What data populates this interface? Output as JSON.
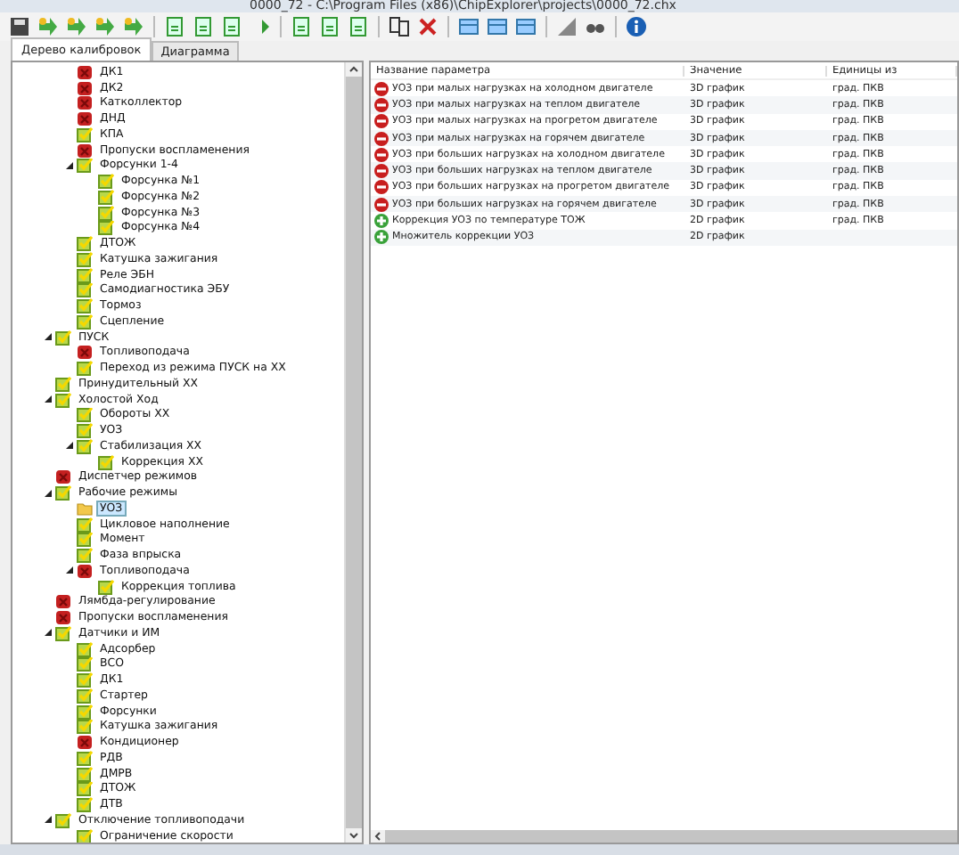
{
  "window": {
    "title": "0000_72 - C:\\Program Files (x86)\\ChipExplorer\\projects\\0000_72.chx"
  },
  "tabs": [
    {
      "label": "Дерево калибровок",
      "selected": true
    },
    {
      "label": "Диаграмма",
      "selected": false
    }
  ],
  "tree": {
    "continued": [
      {
        "label": "ДК1",
        "kind": "error",
        "selected": false
      },
      {
        "label": "ДК2",
        "kind": "error",
        "selected": false
      },
      {
        "label": "Катколлектор",
        "kind": "error",
        "selected": false
      },
      {
        "label": "ДНД",
        "kind": "error",
        "selected": false
      },
      {
        "label": "КПА",
        "kind": "ok",
        "selected": false
      },
      {
        "label": "Пропуски воспламенения",
        "kind": "error",
        "selected": false
      },
      {
        "label": "Форсунки 1-4",
        "kind": "ok",
        "selected": false,
        "expanded": true,
        "children": [
          {
            "label": "Форсунка №1",
            "kind": "ok",
            "selected": false
          },
          {
            "label": "Форсунка №2",
            "kind": "ok",
            "selected": false
          },
          {
            "label": "Форсунка №3",
            "kind": "ok",
            "selected": false
          },
          {
            "label": "Форсунка №4",
            "kind": "ok",
            "selected": false
          }
        ]
      },
      {
        "label": "ДТОЖ",
        "kind": "ok",
        "selected": false
      },
      {
        "label": "Катушка зажигания",
        "kind": "ok",
        "selected": false
      },
      {
        "label": "Реле ЭБН",
        "kind": "ok",
        "selected": false
      },
      {
        "label": "Самодиагностика ЭБУ",
        "kind": "ok",
        "selected": false
      },
      {
        "label": "Тормоз",
        "kind": "ok",
        "selected": false
      },
      {
        "label": "Сцепление",
        "kind": "ok",
        "selected": false
      }
    ],
    "items": [
      {
        "label": "ПУСК",
        "kind": "ok",
        "selected": false,
        "expanded": true,
        "children": [
          {
            "label": "Топливоподача",
            "kind": "error",
            "selected": false
          },
          {
            "label": "Переход из режима ПУСК на XX",
            "kind": "ok",
            "selected": false
          }
        ]
      },
      {
        "label": "Принудительный XX",
        "kind": "ok",
        "selected": false
      },
      {
        "label": "Холостой Ход",
        "kind": "ok",
        "selected": false,
        "expanded": true,
        "children": [
          {
            "label": "Обороты XX",
            "kind": "ok",
            "selected": false
          },
          {
            "label": "УОЗ",
            "kind": "ok",
            "selected": false
          },
          {
            "label": "Стабилизация XX",
            "kind": "ok",
            "selected": false,
            "expanded": true,
            "children": [
              {
                "label": "Коррекция XX",
                "kind": "ok",
                "selected": false
              }
            ]
          }
        ]
      },
      {
        "label": "Диспетчер режимов",
        "kind": "error",
        "selected": false
      },
      {
        "label": "Рабочие режимы",
        "kind": "ok",
        "selected": false,
        "expanded": true,
        "children": [
          {
            "label": "УОЗ",
            "kind": "folder",
            "selected": true
          },
          {
            "label": "Цикловое наполнение",
            "kind": "ok",
            "selected": false
          },
          {
            "label": "Момент",
            "kind": "ok",
            "selected": false
          },
          {
            "label": "Фаза впрыска",
            "kind": "ok",
            "selected": false
          },
          {
            "label": "Топливоподача",
            "kind": "error",
            "selected": false,
            "expanded": true,
            "children": [
              {
                "label": "Коррекция топлива",
                "kind": "ok",
                "selected": false
              }
            ]
          }
        ]
      },
      {
        "label": "Лямбда-регулирование",
        "kind": "error",
        "selected": false
      },
      {
        "label": "Пропуски воспламенения",
        "kind": "error",
        "selected": false
      },
      {
        "label": "Датчики и ИМ",
        "kind": "ok",
        "selected": false,
        "expanded": true,
        "children": [
          {
            "label": "Адсорбер",
            "kind": "ok",
            "selected": false
          },
          {
            "label": "ВСО",
            "kind": "ok",
            "selected": false
          },
          {
            "label": "ДК1",
            "kind": "ok",
            "selected": false
          },
          {
            "label": "Стартер",
            "kind": "ok",
            "selected": false
          },
          {
            "label": "Форсунки",
            "kind": "ok",
            "selected": false
          },
          {
            "label": "Катушка зажигания",
            "kind": "ok",
            "selected": false
          },
          {
            "label": "Кондиционер",
            "kind": "error",
            "selected": false
          },
          {
            "label": "РДВ",
            "kind": "ok",
            "selected": false
          },
          {
            "label": "ДМРВ",
            "kind": "ok",
            "selected": false
          },
          {
            "label": "ДТОЖ",
            "kind": "ok",
            "selected": false
          },
          {
            "label": "ДТВ",
            "kind": "ok",
            "selected": false
          }
        ]
      },
      {
        "label": "Отключение топливоподачи",
        "kind": "ok",
        "selected": false,
        "expanded": true,
        "children": [
          {
            "label": "Ограничение скорости",
            "kind": "ok",
            "selected": false
          }
        ]
      }
    ]
  },
  "table": {
    "columns": [
      "Название параметра",
      "Значение",
      "Единицы из"
    ],
    "rows": [
      {
        "kind": "error",
        "name": "УОЗ при малых нагрузках на холодном двигателе",
        "value": "3D график",
        "unit": "град. ПКВ"
      },
      {
        "kind": "error",
        "name": "УОЗ при малых нагрузках на теплом двигателе",
        "value": "3D график",
        "unit": "град. ПКВ"
      },
      {
        "kind": "error",
        "name": "УОЗ при малых нагрузках на прогретом двигателе",
        "value": "3D график",
        "unit": "град. ПКВ"
      },
      {
        "kind": "error",
        "name": "УОЗ при малых нагрузках на горячем двигателе",
        "value": "3D график",
        "unit": "град. ПКВ"
      },
      {
        "kind": "error",
        "name": "УОЗ при больших нагрузках на холодном двигателе",
        "value": "3D график",
        "unit": "град. ПКВ"
      },
      {
        "kind": "error",
        "name": "УОЗ при больших нагрузках на теплом двигателе",
        "value": "3D график",
        "unit": "град. ПКВ"
      },
      {
        "kind": "error",
        "name": "УОЗ при больших нагрузках на  прогретом двигателе",
        "value": "3D график",
        "unit": "град. ПКВ"
      },
      {
        "kind": "error",
        "name": "УОЗ при больших нагрузках на  горячем двигателе",
        "value": "3D график",
        "unit": "град. ПКВ"
      },
      {
        "kind": "ok",
        "name": "Коррекция УОЗ по температуре ТОЖ",
        "value": "2D график",
        "unit": "град. ПКВ"
      },
      {
        "kind": "ok",
        "name": "Множитель коррекции УОЗ",
        "value": "2D график"
      }
    ]
  }
}
